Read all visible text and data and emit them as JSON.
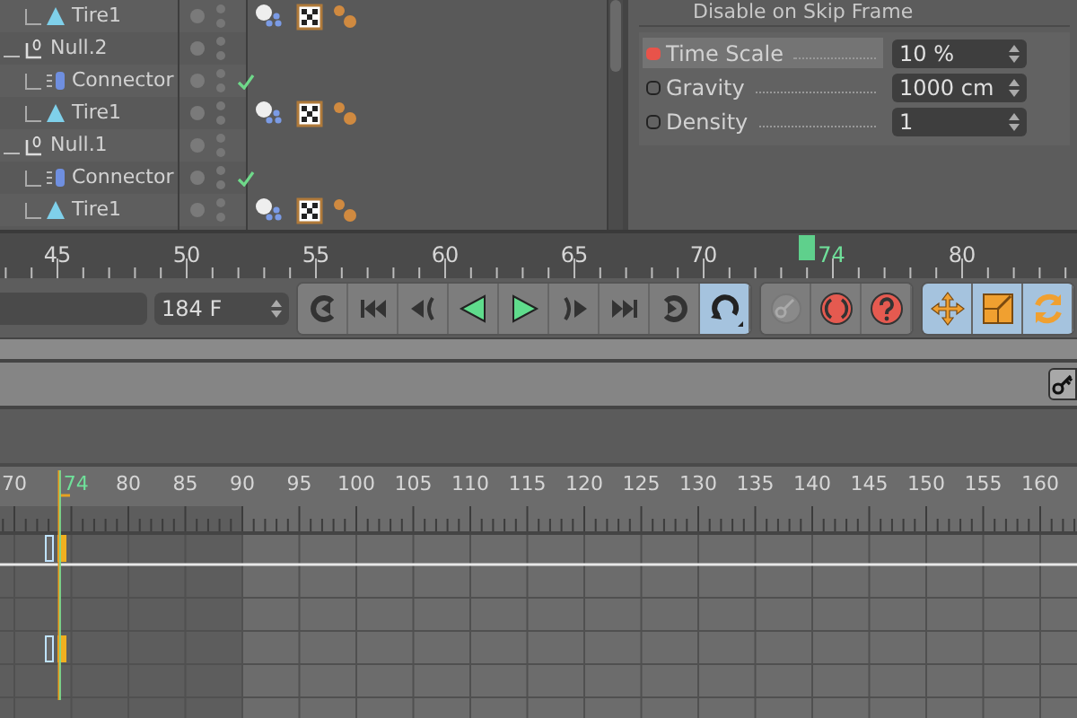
{
  "objects": [
    {
      "name": "Tire1",
      "kind": "tire",
      "enabled": false
    },
    {
      "name": "Null.2",
      "kind": "null",
      "enabled": false,
      "children": [
        {
          "name": "Connector",
          "kind": "connector",
          "enabled": true
        },
        {
          "name": "Tire1",
          "kind": "tire",
          "enabled": false
        }
      ]
    },
    {
      "name": "Null.1",
      "kind": "null",
      "enabled": false,
      "children": [
        {
          "name": "Connector",
          "kind": "connector",
          "enabled": true
        },
        {
          "name": "Tire1",
          "kind": "tire",
          "enabled": false
        }
      ]
    }
  ],
  "attributes": {
    "cut_heading": "Disable on Skip Frame",
    "rows": [
      {
        "label": "Time Scale",
        "value": "10 %",
        "animated": true,
        "selected": true
      },
      {
        "label": "Gravity",
        "value": "1000 cm",
        "animated": false,
        "selected": false
      },
      {
        "label": "Density",
        "value": "1",
        "animated": false,
        "selected": false
      }
    ]
  },
  "top_ruler": {
    "labels": [
      "45",
      "50",
      "55",
      "60",
      "65",
      "70",
      "80"
    ],
    "current": "74"
  },
  "frame_field": "184 F",
  "toolbar_groups": [
    {
      "buttons": [
        {
          "kind": "loop-back",
          "selected": false
        },
        {
          "kind": "go-start",
          "selected": false
        },
        {
          "kind": "prev-key",
          "selected": false
        },
        {
          "kind": "play-back",
          "selected": false
        },
        {
          "kind": "play",
          "selected": false
        },
        {
          "kind": "next-key",
          "selected": false
        },
        {
          "kind": "go-end",
          "selected": false
        },
        {
          "kind": "loop-forward",
          "selected": false
        },
        {
          "kind": "loop",
          "selected": true
        }
      ]
    },
    {
      "buttons": [
        {
          "kind": "key",
          "selected": false
        },
        {
          "kind": "autokey",
          "selected": false
        },
        {
          "kind": "help",
          "selected": false
        }
      ]
    },
    {
      "buttons": [
        {
          "kind": "move",
          "selected": true
        },
        {
          "kind": "scale",
          "selected": true
        },
        {
          "kind": "rotate",
          "selected": true
        }
      ]
    }
  ],
  "timeline": {
    "labels": [
      "70",
      "80",
      "85",
      "90",
      "95",
      "100",
      "105",
      "110",
      "115",
      "120",
      "125",
      "130",
      "135",
      "140",
      "145",
      "150",
      "155",
      "160"
    ],
    "current": "74",
    "tracks": [
      {
        "has_key": true
      },
      {
        "has_key": false
      },
      {
        "has_key": false
      },
      {
        "has_key": true
      },
      {
        "has_key": false
      },
      {
        "has_key": false
      }
    ]
  }
}
